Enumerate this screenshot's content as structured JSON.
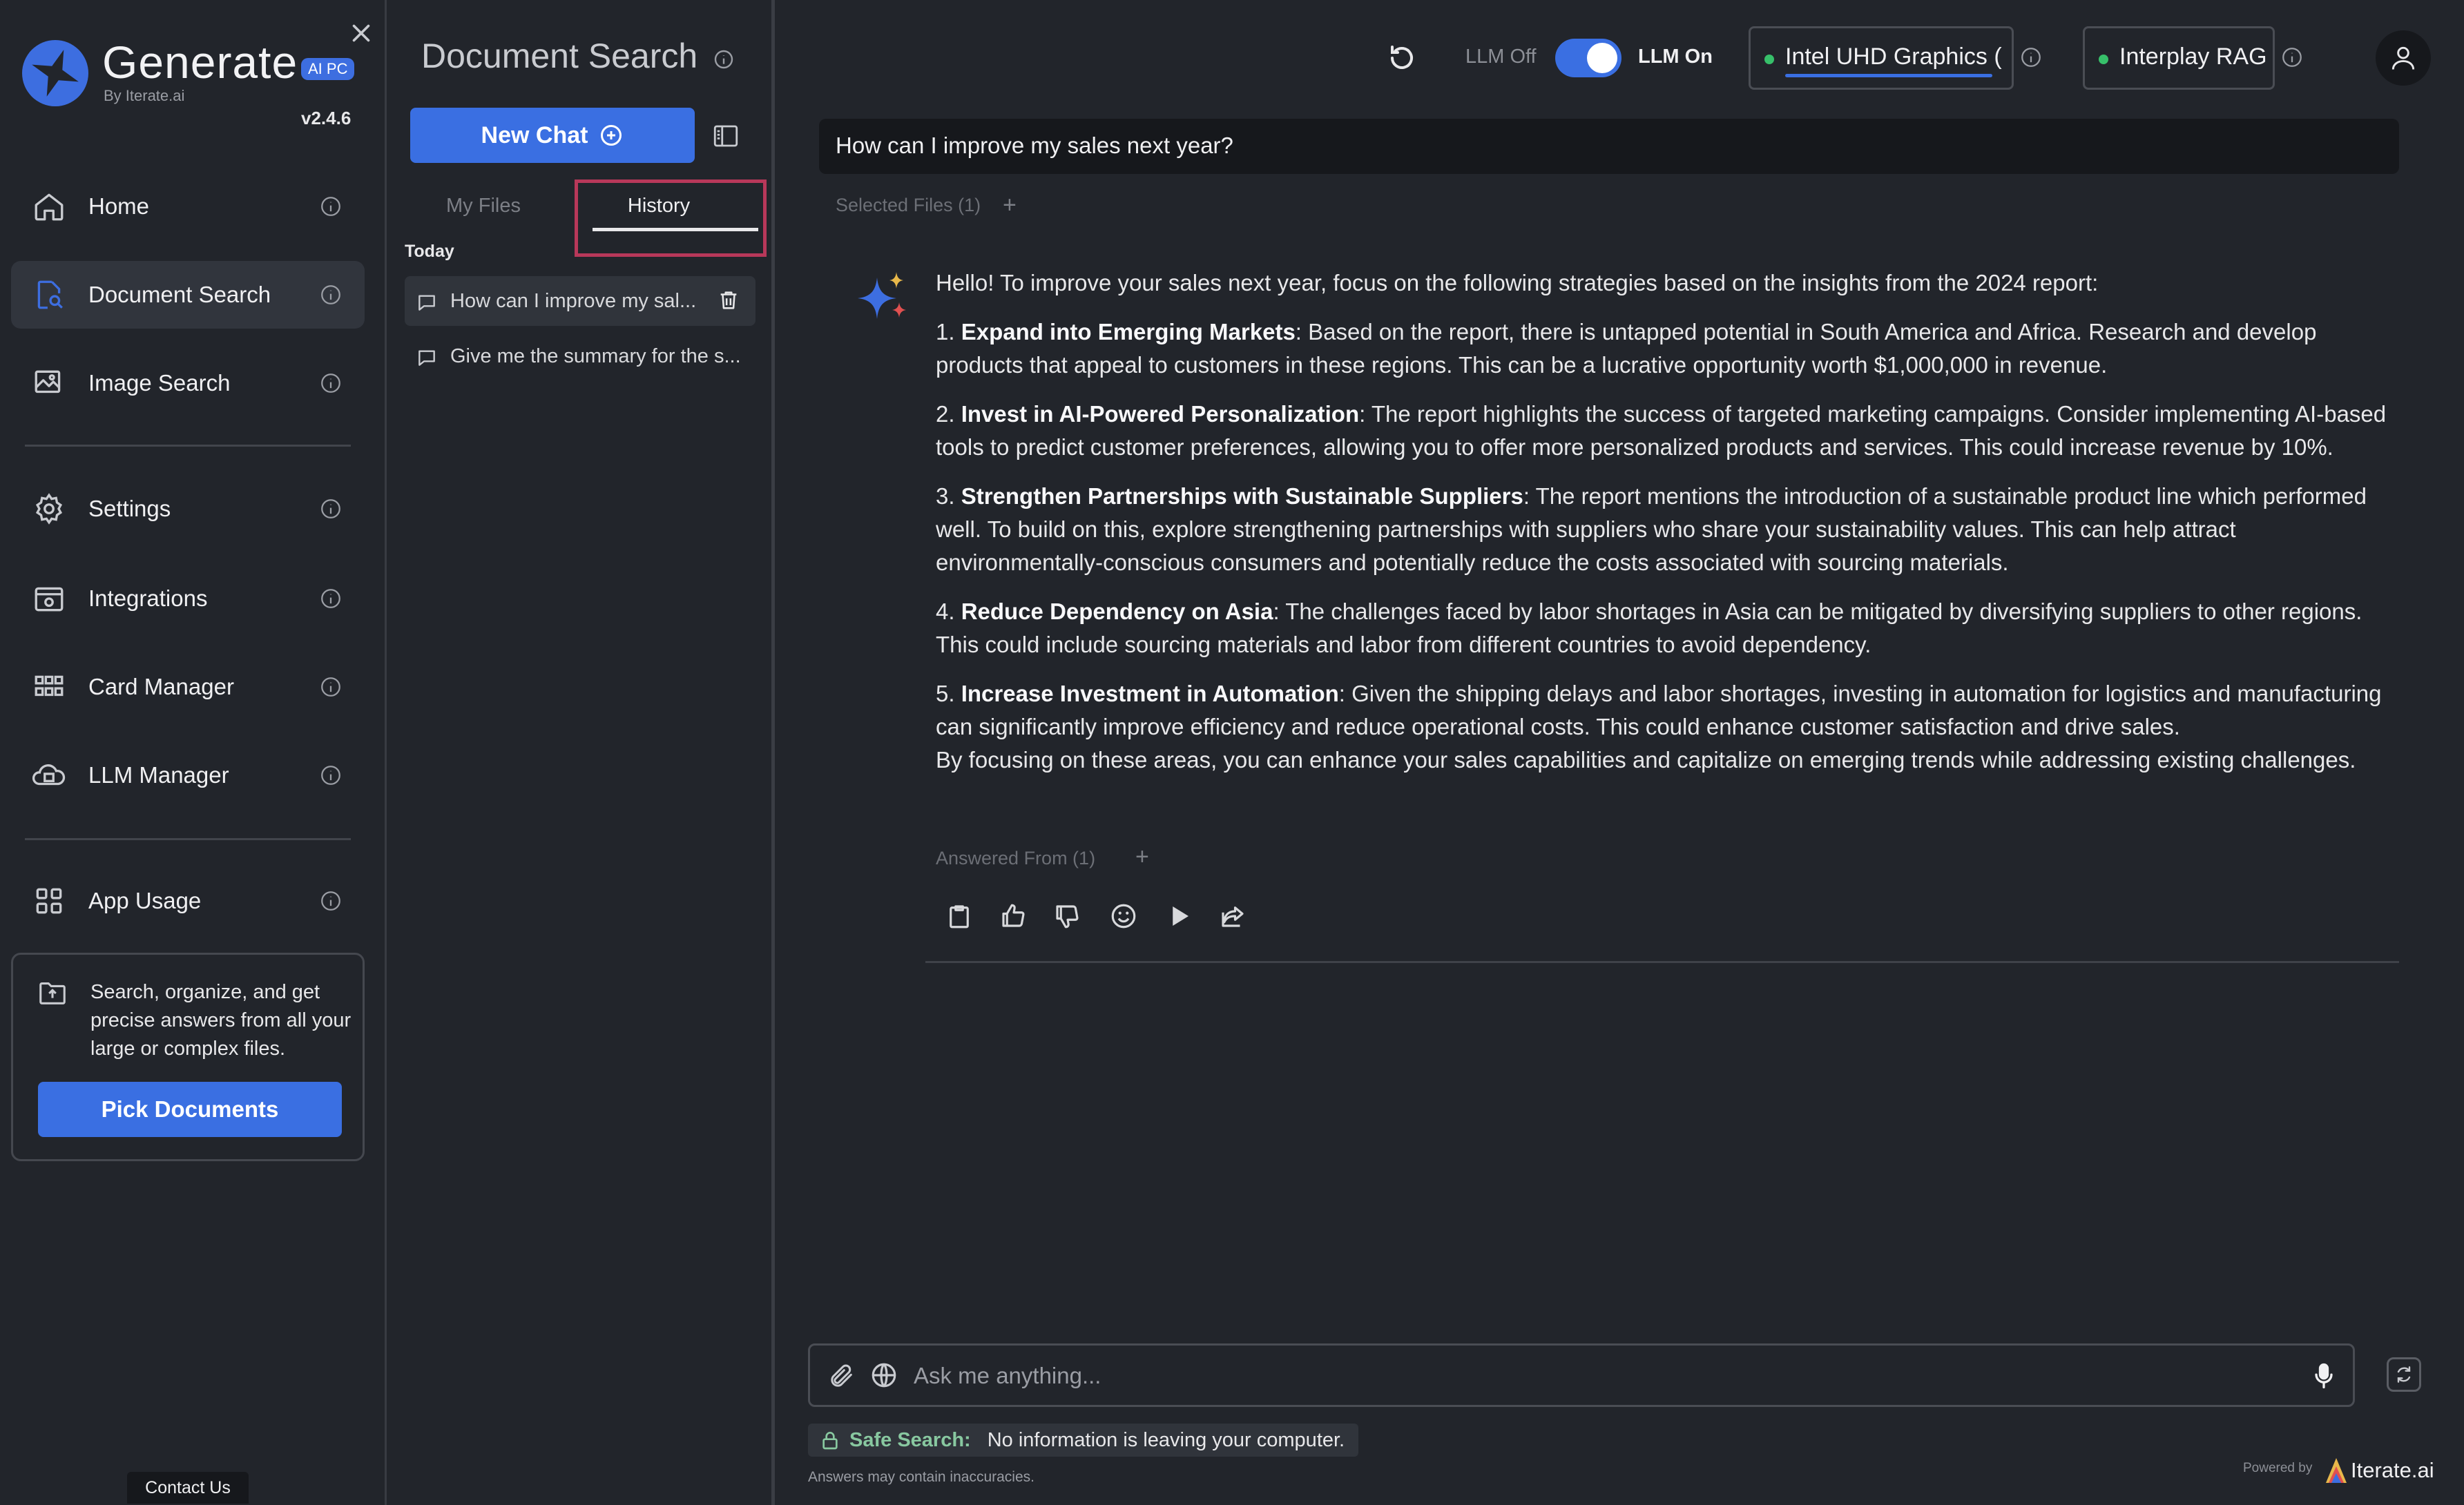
{
  "brand": {
    "name": "Generate",
    "badge": "AI PC",
    "by": "By Iterate.ai",
    "version": "v2.4.6"
  },
  "sidebar": {
    "items": [
      {
        "label": "Home",
        "icon": "home-icon"
      },
      {
        "label": "Document Search",
        "icon": "document-search-icon"
      },
      {
        "label": "Image Search",
        "icon": "image-search-icon"
      },
      {
        "label": "Settings",
        "icon": "gear-icon"
      },
      {
        "label": "Integrations",
        "icon": "integrations-icon"
      },
      {
        "label": "Card Manager",
        "icon": "grid-icon"
      },
      {
        "label": "LLM Manager",
        "icon": "llm-chip-icon"
      },
      {
        "label": "App Usage",
        "icon": "app-usage-icon"
      }
    ],
    "active_index": 1,
    "promo": {
      "text": "Search, organize, and get precise answers from all your large or complex files.",
      "button": "Pick Documents"
    },
    "contact": "Contact Us"
  },
  "panel": {
    "title": "Document Search",
    "new_chat": "New Chat",
    "tabs": [
      {
        "label": "My Files",
        "active": false
      },
      {
        "label": "History",
        "active": true
      }
    ],
    "history_group": "Today",
    "history": [
      {
        "label": "How can I improve my sal...",
        "active": true
      },
      {
        "label": "Give me the summary for the s...",
        "active": false
      }
    ]
  },
  "header": {
    "llm_off": "LLM Off",
    "llm_on": "LLM On",
    "llm_enabled": true,
    "device": "Intel UHD Graphics (",
    "rag": "Interplay RAG",
    "status_color": "#37c06a",
    "accent": "#3a6fe2"
  },
  "chat": {
    "query": "How can I improve my sales next year?",
    "selected_files": "Selected Files (1)",
    "intro": "Hello! To improve your sales next year, focus on the following strategies based on the insights from the 2024 report:",
    "points": [
      {
        "num": "1.",
        "title": "Expand into Emerging Markets",
        "body": ": Based on the report, there is untapped potential in South America and Africa. Research and develop products that appeal to customers in these regions. This can be a lucrative opportunity worth $1,000,000 in revenue."
      },
      {
        "num": "2.",
        "title": "Invest in AI-Powered Personalization",
        "body": ": The report highlights the success of targeted marketing campaigns. Consider implementing AI-based tools to predict customer preferences, allowing you to offer more personalized products and services. This could increase revenue by 10%."
      },
      {
        "num": "3.",
        "title": "Strengthen Partnerships with Sustainable Suppliers",
        "body": ": The report mentions the introduction of a sustainable product line which performed well. To build on this, explore strengthening partnerships with suppliers who share your sustainability values. This can help attract environmentally-conscious consumers and potentially reduce the costs associated with sourcing materials."
      },
      {
        "num": "4.",
        "title": "Reduce Dependency on Asia",
        "body": ": The challenges faced by labor shortages in Asia can be mitigated by diversifying suppliers to other regions. This could include sourcing materials and labor from different countries to avoid dependency."
      },
      {
        "num": "5.",
        "title": "Increase Investment in Automation",
        "body": ": Given the shipping delays and labor shortages, investing in automation for logistics and manufacturing can significantly improve efficiency and reduce operational costs. This could enhance customer satisfaction and drive sales."
      }
    ],
    "closing": "By focusing on these areas, you can enhance your sales capabilities and capitalize on emerging trends while addressing existing challenges.",
    "answered_from": "Answered From (1)"
  },
  "input": {
    "placeholder": "Ask me anything...",
    "safe_label": "Safe Search:",
    "safe_msg": "No information is leaving your computer.",
    "disclaimer": "Answers may contain inaccuracies."
  },
  "footer": {
    "powered_by": "Powered by",
    "company": "Iterate.ai"
  }
}
